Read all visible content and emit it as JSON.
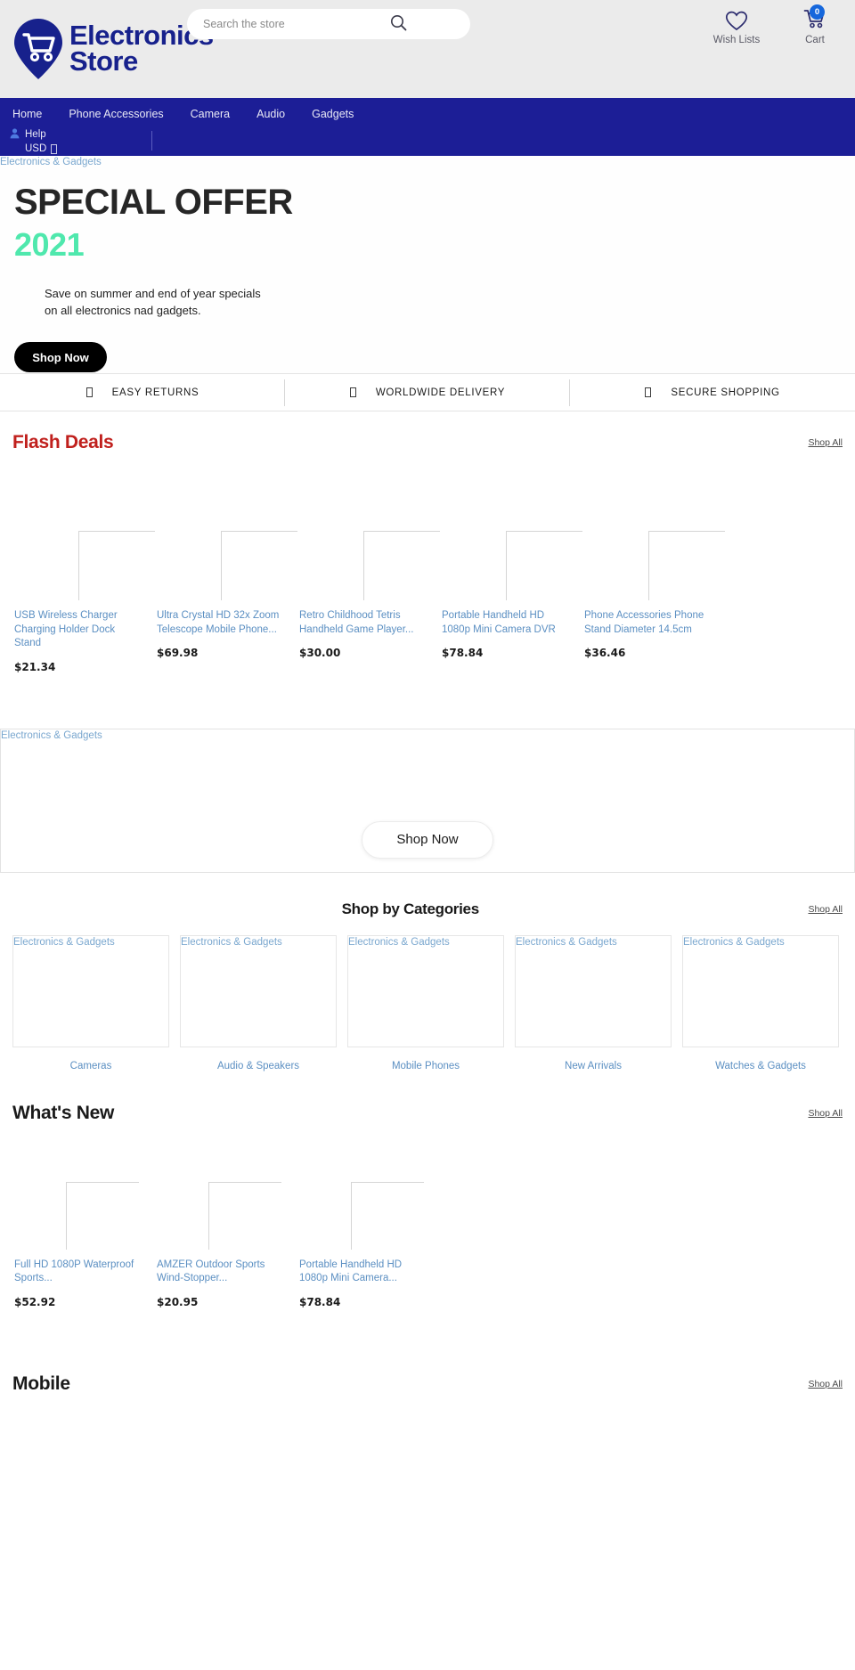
{
  "header": {
    "logo_line1": "Electronics",
    "logo_line2": "Store",
    "search_placeholder": "Search the store",
    "search_value": "",
    "wishlist_label": "Wish Lists",
    "cart_label": "Cart",
    "cart_count": "0"
  },
  "nav": {
    "items": [
      "Home",
      "Phone Accessories",
      "Camera",
      "Audio",
      "Gadgets"
    ],
    "help_label": "Help",
    "currency_label": "USD"
  },
  "hero": {
    "image_alt": "Electronics & Gadgets",
    "title": "SPECIAL OFFER",
    "year": "2021",
    "subtitle_line1": "Save on summer and end of year specials",
    "subtitle_line2": "on all electronics nad gadgets.",
    "cta": "Shop Now",
    "year_color": "#4fe8ad"
  },
  "features": [
    {
      "icon": "return-icon",
      "label": "EASY RETURNS"
    },
    {
      "icon": "globe-delivery-icon",
      "label": "WORLDWIDE DELIVERY"
    },
    {
      "icon": "lock-secure-icon",
      "label": "SECURE SHOPPING"
    }
  ],
  "flash_deals": {
    "title": "Flash Deals",
    "title_color": "#c0201d",
    "shop_all": "Shop All",
    "products": [
      {
        "title": "USB Wireless Charger Charging Holder Dock Stand",
        "price": "$21.34"
      },
      {
        "title": "Ultra Crystal HD 32x Zoom Telescope Mobile Phone...",
        "price": "$69.98"
      },
      {
        "title": "Retro Childhood Tetris Handheld Game Player...",
        "price": "$30.00"
      },
      {
        "title": "Portable Handheld HD 1080p Mini Camera DVR",
        "price": "$78.84"
      },
      {
        "title": "Phone Accessories Phone Stand Diameter 14.5cm",
        "price": "$36.46"
      }
    ]
  },
  "mid_banner": {
    "image_alt": "Electronics & Gadgets",
    "cta": "Shop Now"
  },
  "categories_section": {
    "title": "Shop by Categories",
    "shop_all": "Shop All",
    "items": [
      {
        "image_alt": "Electronics & Gadgets",
        "label": "Cameras"
      },
      {
        "image_alt": "Electronics & Gadgets",
        "label": "Audio & Speakers"
      },
      {
        "image_alt": "Electronics & Gadgets",
        "label": "Mobile Phones"
      },
      {
        "image_alt": "Electronics & Gadgets",
        "label": "New Arrivals"
      },
      {
        "image_alt": "Electronics & Gadgets",
        "label": "Watches & Gadgets"
      }
    ]
  },
  "whats_new": {
    "title": "What's New",
    "shop_all": "Shop All",
    "products": [
      {
        "title": "Full HD 1080P Waterproof Sports...",
        "price": "$52.92"
      },
      {
        "title": "AMZER Outdoor Sports Wind-Stopper...",
        "price": "$20.95"
      },
      {
        "title": "Portable Handheld HD 1080p Mini Camera...",
        "price": "$78.84"
      }
    ]
  },
  "mobile_section": {
    "title": "Mobile",
    "shop_all": "Shop All"
  },
  "colors": {
    "nav_bg": "#1c1e96",
    "header_bg": "#ebebeb",
    "link_blue": "#5b8fc2",
    "accent_red": "#c0201d",
    "badge_blue": "#1667dc"
  }
}
